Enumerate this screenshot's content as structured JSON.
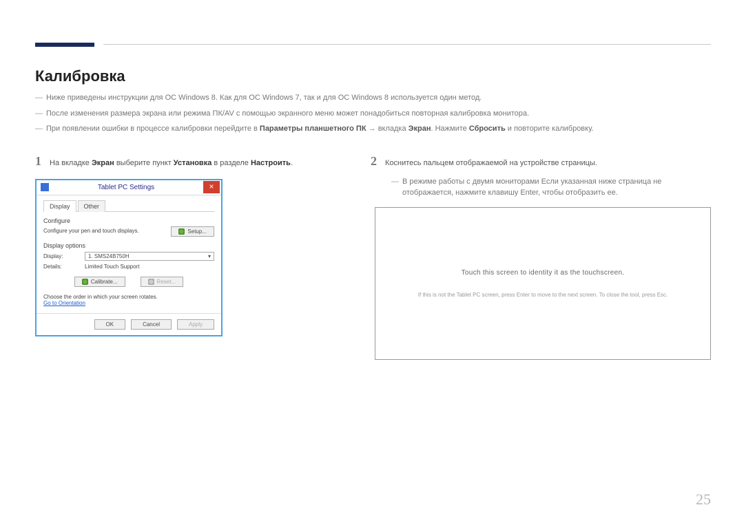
{
  "title": "Калибровка",
  "notes": {
    "n1": "Ниже приведены инструкции для ОС Windows 8. Как для ОС Windows 7, так и для ОС Windows 8 используется один метод.",
    "n2": "После изменения размера экрана или режима ПК/AV с помощью экранного меню может понадобиться повторная калибровка монитора.",
    "n3_a": "При появлении ошибки в процессе калибровки перейдите в ",
    "n3_b1": "Параметры планшетного ПК",
    "n3_arrow": " → ",
    "n3_b2": "вкладка ",
    "n3_b3": "Экран",
    "n3_c": ". Нажмите ",
    "n3_b4": "Сбросить",
    "n3_d": " и повторите калибровку."
  },
  "step1": {
    "num": "1",
    "t1": "На вкладке ",
    "b1": "Экран",
    "t2": " выберите пункт ",
    "b2": "Установка",
    "t3": " в разделе ",
    "b3": "Настроить",
    "t4": "."
  },
  "dialog": {
    "title": "Tablet PC Settings",
    "close": "×",
    "tab_display": "Display",
    "tab_other": "Other",
    "configure_label": "Configure",
    "configure_text": "Configure your pen and touch displays.",
    "setup_btn": "Setup...",
    "display_options": "Display options",
    "display_lbl": "Display:",
    "display_val": "1. SMS24B750H",
    "details_lbl": "Details:",
    "details_val": "Limited Touch Support",
    "calibrate_btn": "Calibrate...",
    "reset_btn": "Reset...",
    "rotate_note": "Choose the order in which your screen rotates.",
    "orientation_link": "Go to Orientation",
    "ok": "OK",
    "cancel": "Cancel",
    "apply": "Apply"
  },
  "step2": {
    "num": "2",
    "text": "Коснитесь пальцем отображаемой на устройстве страницы.",
    "sub": "В режиме работы с двумя мониторами Если указанная ниже страница не отображается, нажмите клавишу Enter, чтобы отобразить ее."
  },
  "touch": {
    "main": "Touch this screen to identity it as the touchscreen.",
    "sub": "If this is not the Tablet PC screen, press Enter to move to the next screen. To close the tool, press Esc."
  },
  "page_num": "25"
}
